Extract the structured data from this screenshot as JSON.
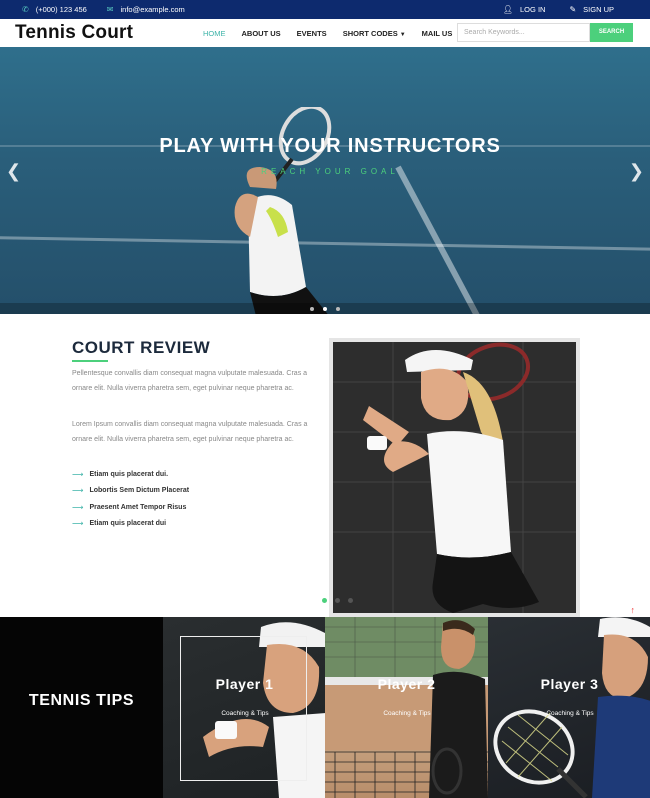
{
  "topbar": {
    "phone": "(+000) 123 456",
    "email": "info@example.com",
    "login": "LOG IN",
    "signup": "SIGN UP"
  },
  "nav": {
    "logo": "Tennis Court",
    "items": [
      "HOME",
      "ABOUT US",
      "EVENTS",
      "SHORT CODES",
      "MAIL US"
    ],
    "search_placeholder": "Search Keywords...",
    "search_button": "SEARCH"
  },
  "hero": {
    "title": "PLAY WITH YOUR INSTRUCTORS",
    "subtitle": "REACH YOUR GOAL",
    "slide_count": 3,
    "active_slide": 2
  },
  "review": {
    "title": "COURT REVIEW",
    "para1": "Pellentesque convallis diam consequat magna vulputate malesuada. Cras a ornare elit. Nulla viverra pharetra sem, eget pulvinar neque pharetra ac.",
    "para2": "Lorem Ipsum convallis diam consequat magna vulputate malesuada. Cras a ornare elit. Nulla viverra pharetra sem, eget pulvinar neque pharetra ac.",
    "bullets": [
      "Etiam quis placerat dui.",
      "Lobortis Sem Dictum Placerat",
      "Praesent Amet Tempor Risus",
      "Etiam quis placerat dui"
    ]
  },
  "tips": {
    "title": "TENNIS TIPS",
    "cards": [
      {
        "name": "Player 1",
        "desc": "Coaching & Tips"
      },
      {
        "name": "Player 2",
        "desc": "Coaching & Tips"
      },
      {
        "name": "Player 3",
        "desc": "Coaching & Tips"
      }
    ]
  },
  "colors": {
    "topbar": "#0d2a6e",
    "accent_green": "#4cd07c",
    "accent_teal": "#3fb4a9"
  }
}
